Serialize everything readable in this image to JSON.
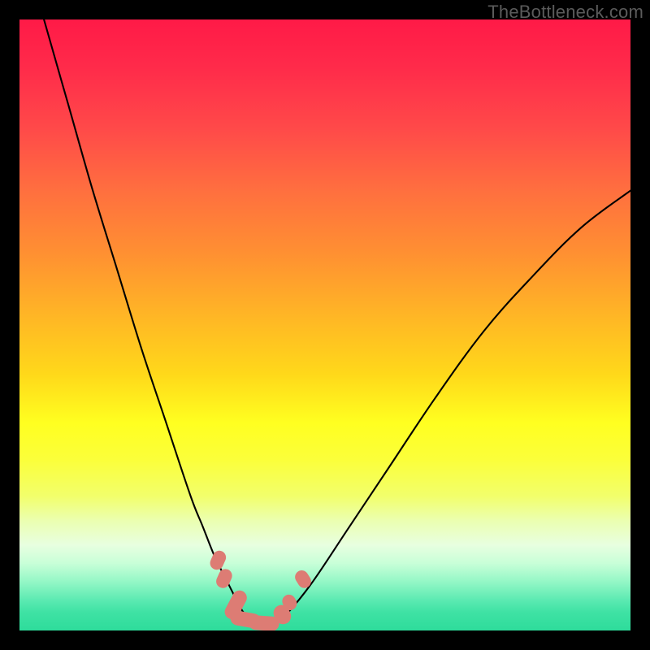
{
  "watermark": {
    "text": "TheBottleneck.com"
  },
  "chart_data": {
    "type": "line",
    "title": "",
    "xlabel": "",
    "ylabel": "",
    "xlim": [
      0,
      100
    ],
    "ylim": [
      0,
      100
    ],
    "grid": false,
    "legend": false,
    "series": [
      {
        "name": "bottleneck-curve",
        "color": "#000000",
        "x": [
          4,
          8,
          12,
          16,
          20,
          24,
          28,
          30,
          32,
          34,
          35,
          36,
          37,
          38,
          39,
          40,
          42,
          44,
          48,
          54,
          60,
          68,
          76,
          84,
          92,
          100
        ],
        "y": [
          100,
          86,
          72,
          59,
          46,
          34,
          22,
          17,
          12,
          8,
          6,
          4,
          2.5,
          1.5,
          1,
          1,
          1.5,
          3,
          8,
          17,
          26,
          38,
          49,
          58,
          66,
          72
        ]
      }
    ],
    "markers": [
      {
        "name": "highlight-dots",
        "color": "#dd7c74",
        "shape": "rounded",
        "points": [
          {
            "x": 32.5,
            "y": 11.5,
            "w": 2.2,
            "h": 3.2,
            "rot": 24
          },
          {
            "x": 33.5,
            "y": 8.5,
            "w": 2.2,
            "h": 3.2,
            "rot": 24
          },
          {
            "x": 35.4,
            "y": 4.2,
            "w": 2.4,
            "h": 5.0,
            "rot": 28
          },
          {
            "x": 37.0,
            "y": 1.8,
            "w": 5.0,
            "h": 2.4,
            "rot": 10
          },
          {
            "x": 40.0,
            "y": 1.2,
            "w": 5.0,
            "h": 2.4,
            "rot": 4
          },
          {
            "x": 43.0,
            "y": 2.6,
            "w": 2.6,
            "h": 3.2,
            "rot": -26
          },
          {
            "x": 44.2,
            "y": 4.6,
            "w": 2.2,
            "h": 2.6,
            "rot": -30
          },
          {
            "x": 46.4,
            "y": 8.4,
            "w": 2.2,
            "h": 3.0,
            "rot": -32
          }
        ]
      }
    ],
    "background_gradient": {
      "direction": "vertical",
      "stops": [
        {
          "pos": 0.0,
          "color": "#ff1a47"
        },
        {
          "pos": 0.4,
          "color": "#ff8f32"
        },
        {
          "pos": 0.66,
          "color": "#ffff20"
        },
        {
          "pos": 0.88,
          "color": "#e8ffe0"
        },
        {
          "pos": 1.0,
          "color": "#2edc9b"
        }
      ]
    }
  }
}
